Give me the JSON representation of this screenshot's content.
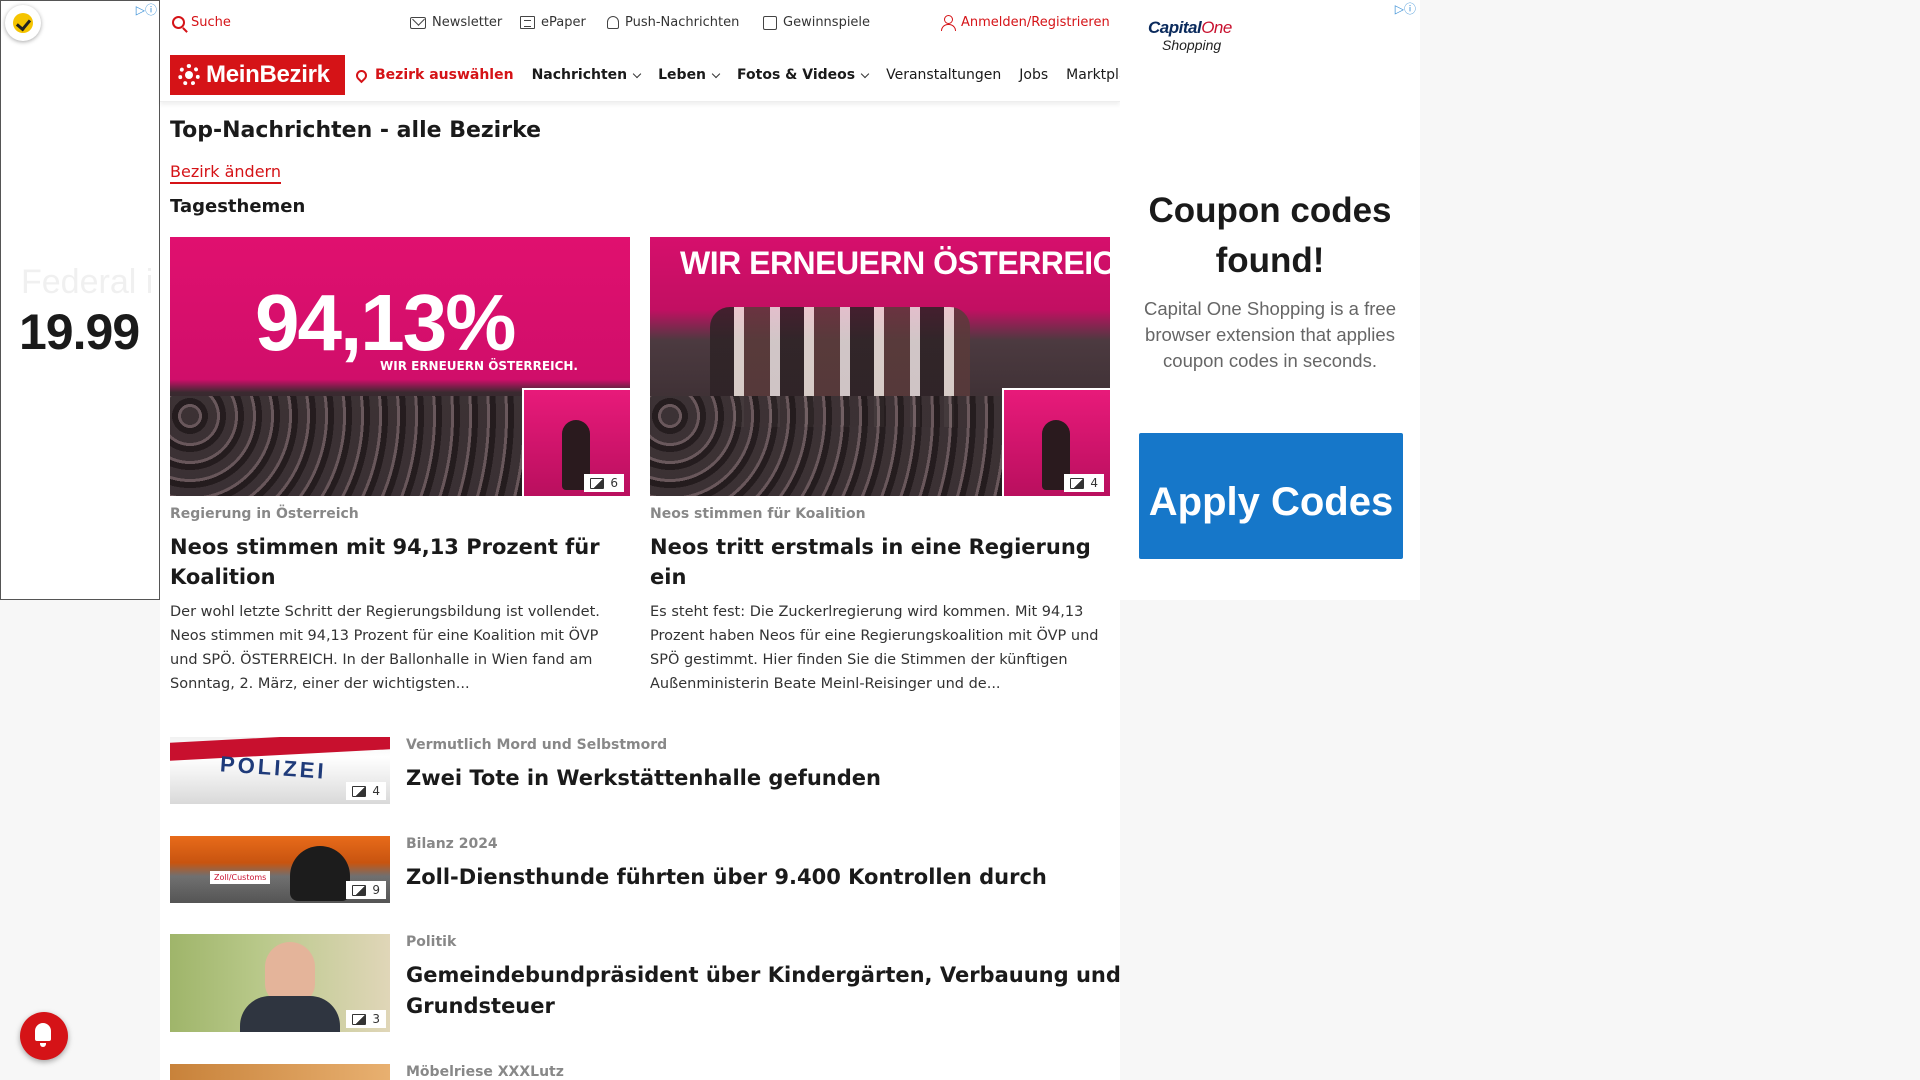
{
  "left_ad": {
    "ghost_text": "Federal i",
    "price": "19.99"
  },
  "topbar": {
    "search": "Suche",
    "newsletter": "Newsletter",
    "epaper": "ePaper",
    "push": "Push-Nachrichten",
    "games": "Gewinnspiele",
    "login": "Anmelden/Registrieren"
  },
  "nav": {
    "logo": "MeinBezirk",
    "bezirk": "Bezirk auswählen",
    "items": [
      "Nachrichten",
      "Leben",
      "Fotos & Videos",
      "Veranstaltungen",
      "Jobs",
      "Marktplatz"
    ]
  },
  "page": {
    "title": "Top-Nachrichten - alle Bezirke",
    "change_link": "Bezirk ändern",
    "section": "Tagesthemen"
  },
  "featured": [
    {
      "image_text_big": "94,13%",
      "image_text_sub": "WIR ERNEUERN ÖSTERREICH.",
      "photo_count": "6",
      "kicker": "Regierung in Österreich",
      "headline": "Neos stimmen mit 94,13 Prozent für Koalition",
      "teaser": "Der wohl letzte Schritt der Regierungsbildung ist vollendet. Neos stimmen mit 94,13 Prozent für eine Koalition mit ÖVP und SPÖ. ÖSTERREICH. In der Ballonhalle in Wien fand am Sonntag, 2. März, einer der wichtigsten..."
    },
    {
      "image_text_big": "WIR ERNEUERN ÖSTERREICH",
      "photo_count": "4",
      "kicker": "Neos stimmen für Koalition",
      "headline": "Neos tritt erstmals in eine Regierung ein",
      "teaser": "Es steht fest: Die Zuckerlregierung wird kommen. Mit 94,13 Prozent haben Neos für eine Regierungskoalition mit ÖVP und SPÖ gestimmt. Hier finden Sie die Stimmen der künftigen Außenministerin Beate Meinl-Reisinger und de..."
    }
  ],
  "list": [
    {
      "kicker": "Vermutlich Mord und Selbstmord",
      "headline": "Zwei Tote in Werkstättenhalle gefunden",
      "photo_count": "4",
      "image_text": "POLIZEI"
    },
    {
      "kicker": "Bilanz 2024",
      "headline": "Zoll-Diensthunde führten über 9.400 Kontrollen durch",
      "photo_count": "9",
      "image_text": "Zoll/Customs"
    },
    {
      "kicker": "Politik",
      "headline": "Gemeindebundpräsident über Kindergärten, Verbauung und Grundsteuer",
      "photo_count": "3"
    },
    {
      "kicker": "Möbelriese XXXLutz",
      "headline": ""
    }
  ],
  "right_ad": {
    "brand": "Capital",
    "brand_script": "One",
    "brand_sub": "Shopping",
    "headline": "Coupon codes found!",
    "description": "Capital One Shopping is a free browser extension that applies coupon codes in seconds.",
    "button": "Apply Codes"
  }
}
